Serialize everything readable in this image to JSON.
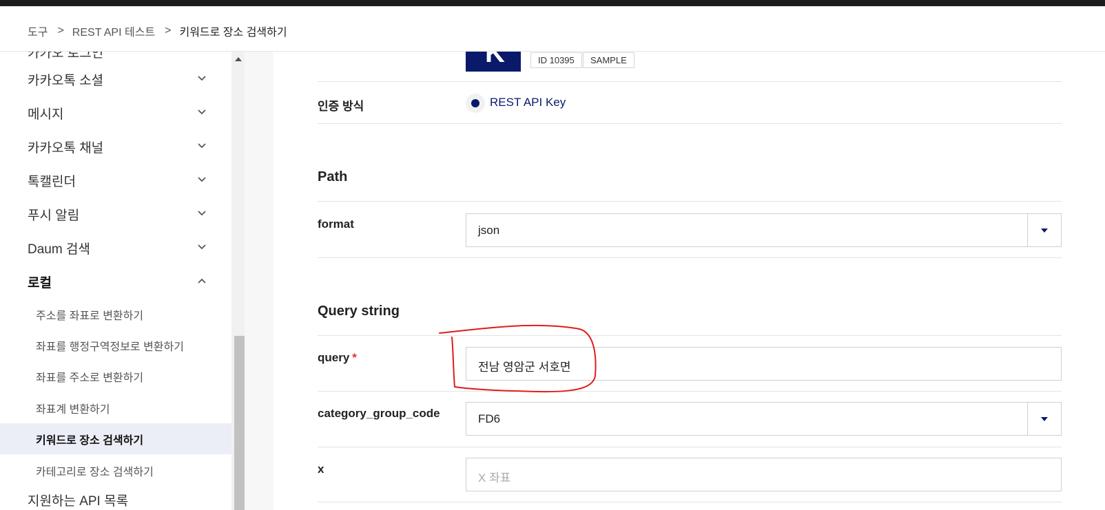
{
  "breadcrumb": {
    "items": [
      "도구",
      "REST API 테스트"
    ],
    "current": "키워드로 장소 검색하기",
    "separator": ">"
  },
  "sidebar": {
    "cut_top": "카카오 로그인",
    "items": [
      {
        "label": "카카오톡 소셜",
        "expanded": false
      },
      {
        "label": "메시지",
        "expanded": false
      },
      {
        "label": "카카오톡 채널",
        "expanded": false
      },
      {
        "label": "톡캘린더",
        "expanded": false
      },
      {
        "label": "푸시 알림",
        "expanded": false
      },
      {
        "label": "Daum 검색",
        "expanded": false
      },
      {
        "label": "로컬",
        "expanded": true
      }
    ],
    "sub_items": [
      {
        "label": "주소를 좌표로 변환하기",
        "active": false
      },
      {
        "label": "좌표를 행정구역정보로 변환하기",
        "active": false
      },
      {
        "label": "좌표를 주소로 변환하기",
        "active": false
      },
      {
        "label": "좌표계 변환하기",
        "active": false
      },
      {
        "label": "키워드로 장소 검색하기",
        "active": true
      },
      {
        "label": "카테고리로 장소 검색하기",
        "active": false
      }
    ],
    "cut_bottom": "지원하는 API 목록"
  },
  "app": {
    "logo_letter": "K",
    "id_tag": "ID 10395",
    "sample_tag": "SAMPLE"
  },
  "auth": {
    "label": "인증 방식",
    "option": "REST API Key"
  },
  "path": {
    "title": "Path",
    "format_label": "format",
    "format_value": "json"
  },
  "query": {
    "title": "Query string",
    "query_label": "query",
    "required_mark": "*",
    "query_value": "전남 영암군 서호면",
    "category_label": "category_group_code",
    "category_value": "FD6",
    "x_label": "x",
    "x_placeholder": "X 좌표"
  },
  "colors": {
    "brand": "#0a1a6b",
    "required": "#e0322b",
    "annotation": "#e01b1b",
    "active_bg": "#ebeef6"
  }
}
